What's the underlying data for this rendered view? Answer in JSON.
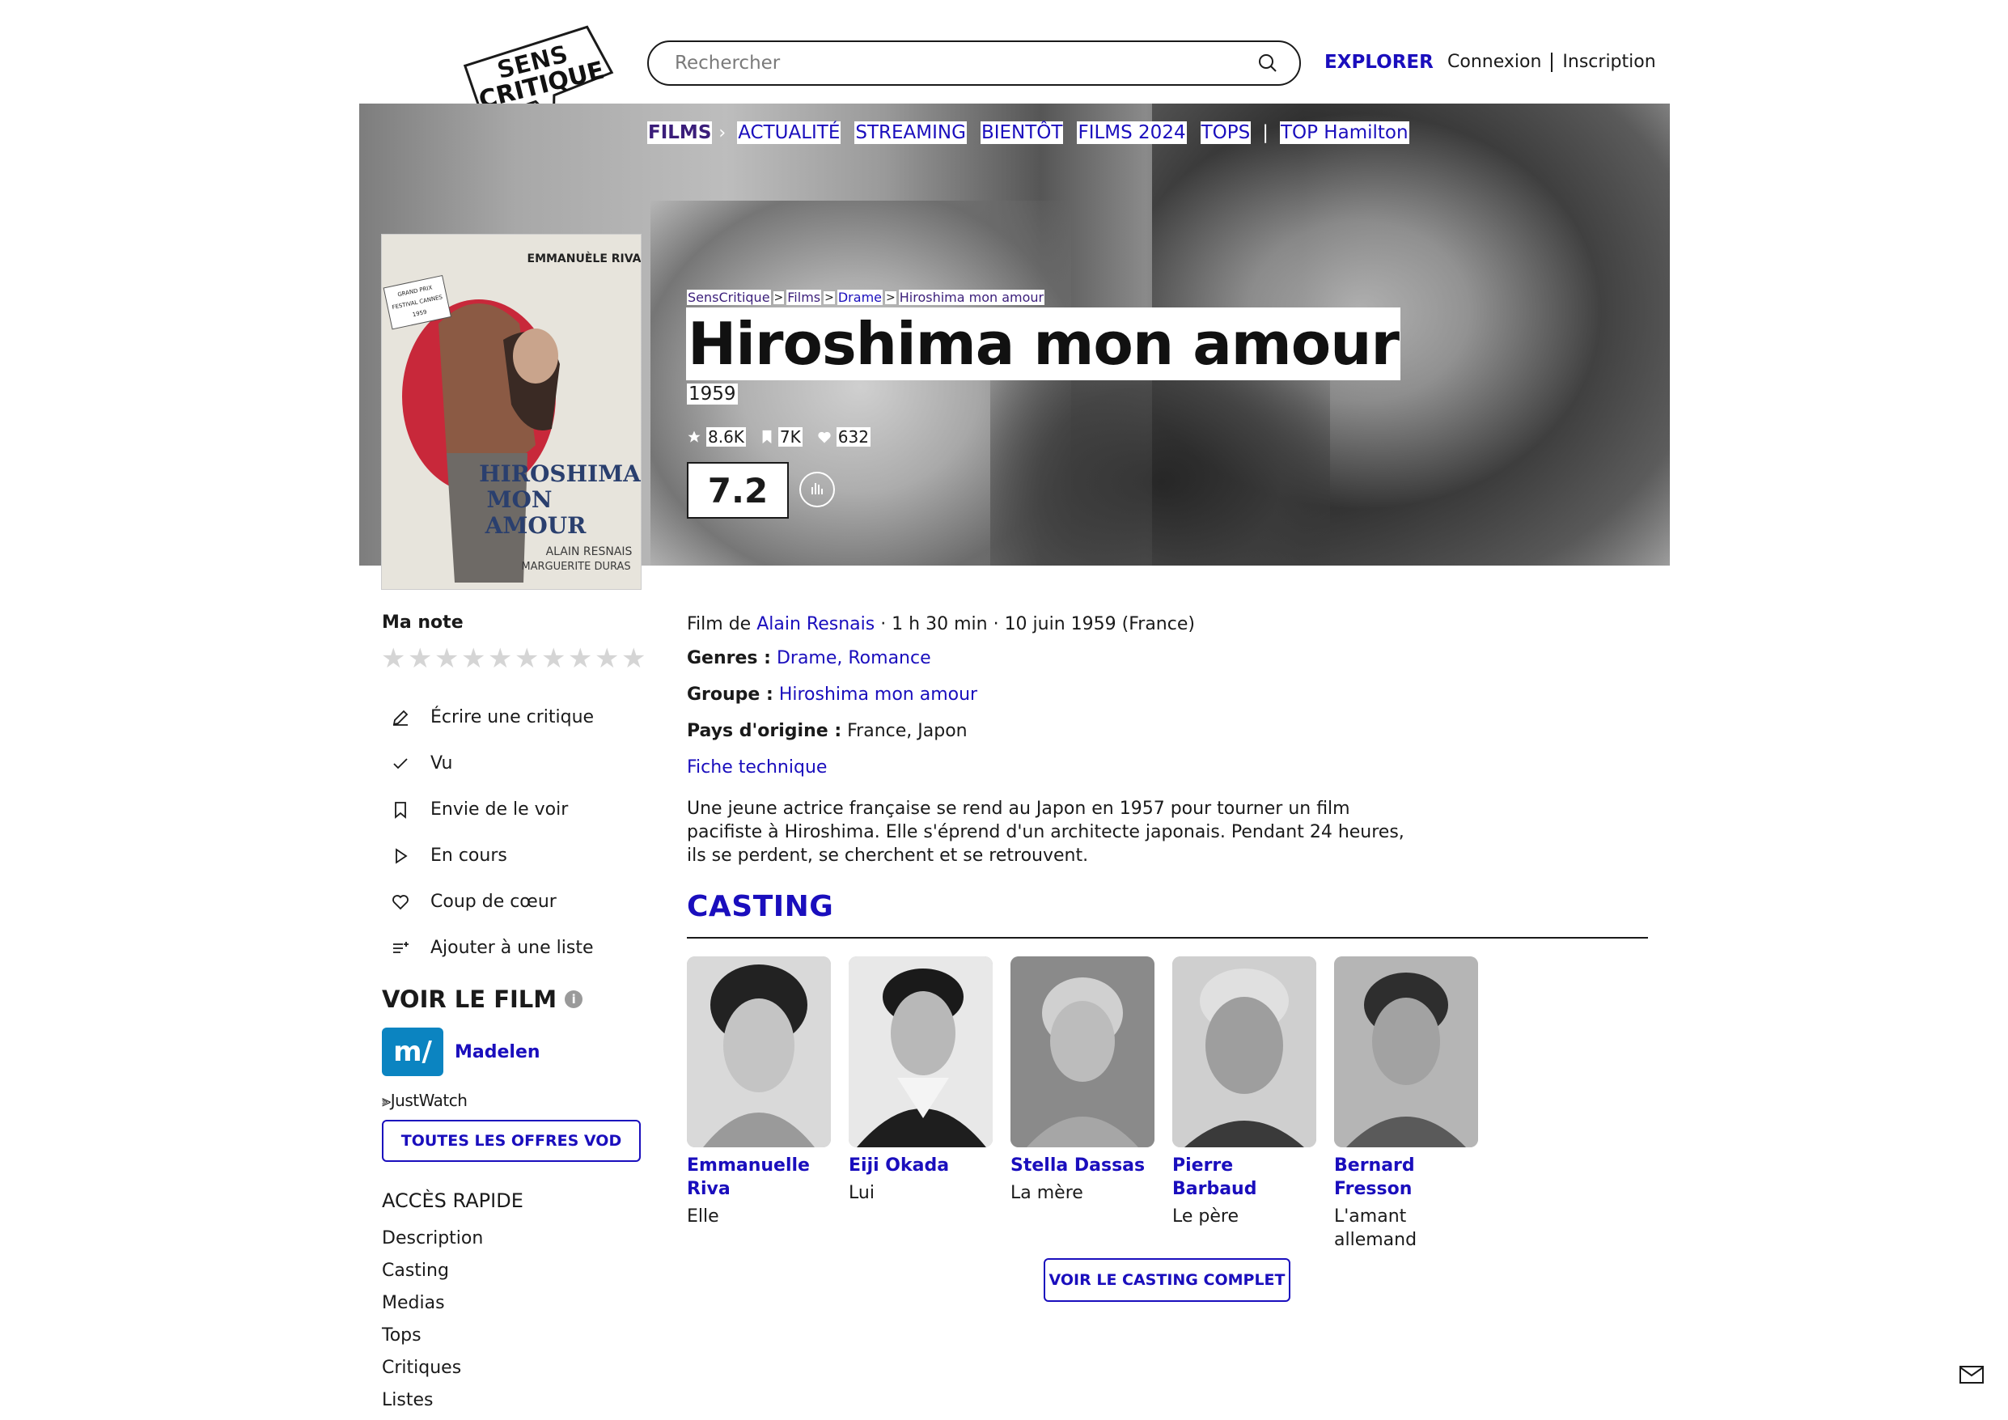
{
  "header": {
    "logo_text": [
      "SENS",
      "CRITIQUE"
    ],
    "search_placeholder": "Rechercher",
    "explorer": "EXPLORER",
    "connexion": "Connexion",
    "inscription": "Inscription"
  },
  "nav": {
    "films": "FILMS",
    "items": [
      "ACTUALITÉ",
      "STREAMING",
      "BIENTÔT",
      "FILMS 2024",
      "TOPS"
    ],
    "top": "TOP Hamilton"
  },
  "poster": {
    "actor": "EMMANUÈLE RIVA",
    "award": [
      "GRAND PRIX",
      "FESTIVAL CANNES",
      "1959"
    ],
    "title_lines": [
      "HIROSHIMA",
      "MON",
      "AMOUR"
    ],
    "credits": [
      "ALAIN RESNAIS",
      "MARGUERITE DURAS"
    ]
  },
  "breadcrumb": [
    "SensCritique",
    "Films",
    "Drame",
    "Hiroshima mon amour"
  ],
  "movie": {
    "title": "Hiroshima mon amour",
    "year": "1959",
    "stats": {
      "ratings": "8.6K",
      "wishlist": "7K",
      "favorites": "632"
    },
    "rating": "7.2",
    "film_de": "Film de ",
    "director": "Alain Resnais",
    "details": " · 1 h 30 min · 10 juin 1959 (France)",
    "genres_label": "Genres :",
    "genres": "Drame, Romance",
    "groupe_label": "Groupe :",
    "groupe": "Hiroshima mon amour",
    "pays_label": "Pays d'origine :",
    "pays": "France, Japon",
    "fiche": "Fiche technique",
    "synopsis": "Une jeune actrice française se rend au Japon en 1957 pour tourner un film pacifiste à Hiroshima. Elle s'éprend d'un architecte japonais. Pendant 24 heures, ils se perdent, se cherchent et se retrouvent."
  },
  "sidebar": {
    "ma_note": "Ma note",
    "actions": [
      "Écrire une critique",
      "Vu",
      "Envie de le voir",
      "En cours",
      "Coup de cœur",
      "Ajouter à une liste"
    ],
    "voir_le_film": "VOIR LE FILM",
    "provider": "Madelen",
    "justwatch": "JustWatch",
    "vod_button": "TOUTES LES OFFRES VOD",
    "acces_title": "ACCÈS RAPIDE",
    "acces": [
      "Description",
      "Casting",
      "Medias",
      "Tops",
      "Critiques",
      "Listes"
    ]
  },
  "casting": {
    "title": "CASTING",
    "people": [
      {
        "name": "Emmanuelle Riva",
        "role": "Elle"
      },
      {
        "name": "Eiji Okada",
        "role": "Lui"
      },
      {
        "name": "Stella Dassas",
        "role": "La mère"
      },
      {
        "name": "Pierre Barbaud",
        "role": "Le père"
      },
      {
        "name": "Bernard Fresson",
        "role": "L'amant allemand"
      }
    ],
    "button": "VOIR LE CASTING COMPLET"
  },
  "colors": {
    "accent": "#1a0ebd",
    "nav_active": "#3b1e7a",
    "madelen": "#0b84c1"
  }
}
